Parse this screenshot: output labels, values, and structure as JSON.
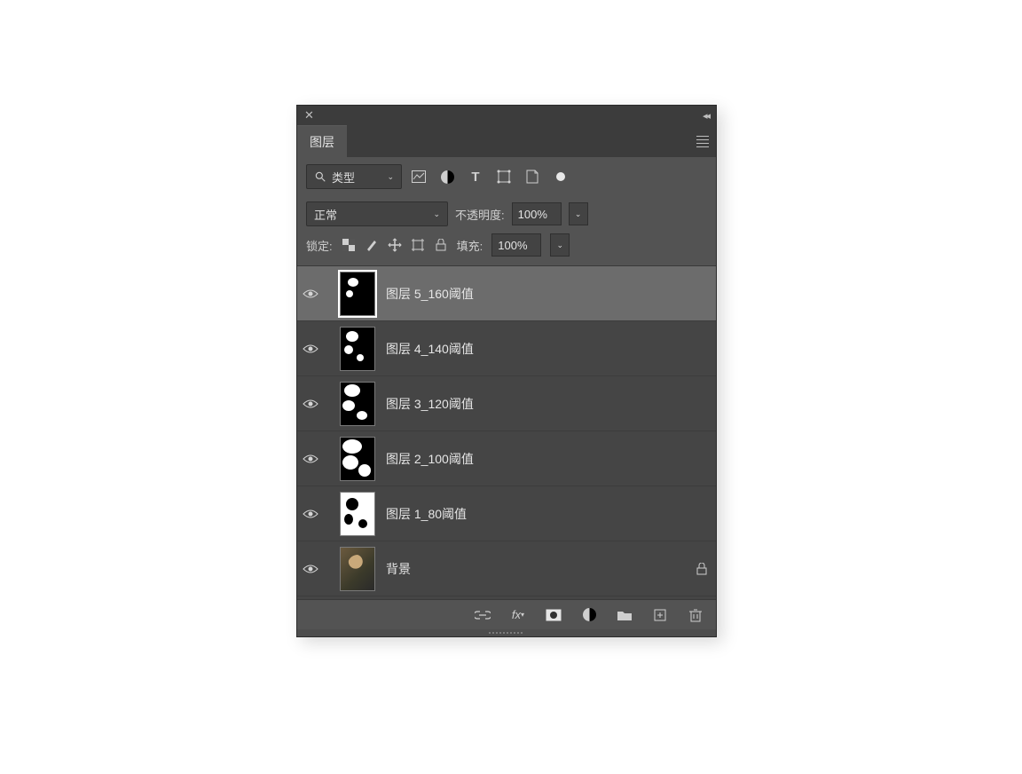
{
  "panel": {
    "title": "图层",
    "filter_kind": "类型",
    "blend_mode": "正常",
    "opacity_label": "不透明度:",
    "opacity_value": "100%",
    "lock_label": "锁定:",
    "fill_label": "填充:",
    "fill_value": "100%"
  },
  "layers": [
    {
      "name": "图层 5_160阈值",
      "visible": true,
      "selected": true,
      "locked": false,
      "thumb": "t160"
    },
    {
      "name": "图层 4_140阈值",
      "visible": true,
      "selected": false,
      "locked": false,
      "thumb": "t140"
    },
    {
      "name": "图层 3_120阈值",
      "visible": true,
      "selected": false,
      "locked": false,
      "thumb": "t120"
    },
    {
      "name": "图层 2_100阈值",
      "visible": true,
      "selected": false,
      "locked": false,
      "thumb": "t100"
    },
    {
      "name": "图层 1_80阈值",
      "visible": true,
      "selected": false,
      "locked": false,
      "thumb": "t80"
    },
    {
      "name": "背景",
      "visible": true,
      "selected": false,
      "locked": true,
      "thumb": "bg"
    }
  ]
}
